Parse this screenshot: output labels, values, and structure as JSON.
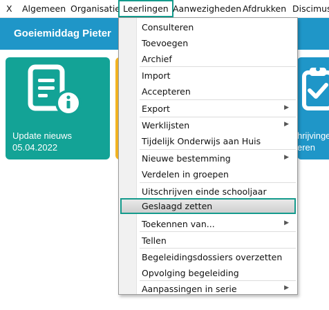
{
  "menubar": {
    "items": [
      "X",
      "Algemeen",
      "Organisatie",
      "Leerlingen",
      "Aanwezigheden",
      "Afdrukken",
      "Discimus"
    ],
    "active_index": 3
  },
  "header": {
    "greeting": "Goeiemiddag Pieter"
  },
  "tiles": {
    "news": {
      "line1": "Update nieuws",
      "line2": "05.04.2022",
      "color": "#13a396",
      "icon": "document-info-icon"
    },
    "yellow": {
      "color": "#f3b423"
    },
    "partial": {
      "line1": "hrijvinge",
      "line2": "eren",
      "color": "#1f96c8",
      "icon": "clipboard-check-icon"
    }
  },
  "dropdown": {
    "items": [
      {
        "label": "Consulteren",
        "submenu": false
      },
      {
        "label": "Toevoegen",
        "submenu": false
      },
      {
        "label": "Archief",
        "submenu": false
      },
      {
        "label": "Import",
        "submenu": false
      },
      {
        "label": "Accepteren",
        "submenu": false
      },
      {
        "label": "Export",
        "submenu": true
      },
      {
        "label": "Werklijsten",
        "submenu": true
      },
      {
        "label": "Tijdelijk Onderwijs aan Huis",
        "submenu": false
      },
      {
        "label": "Nieuwe bestemming",
        "submenu": true
      },
      {
        "label": "Verdelen in groepen",
        "submenu": false
      },
      {
        "label": "Uitschrijven einde schooljaar",
        "submenu": false
      },
      {
        "label": "Geslaagd zetten",
        "submenu": false
      },
      {
        "label": "Toekennen van...",
        "submenu": true
      },
      {
        "label": "Tellen",
        "submenu": false
      },
      {
        "label": "Begeleidingsdossiers overzetten",
        "submenu": false
      },
      {
        "label": "Opvolging begeleiding",
        "submenu": false
      },
      {
        "label": "Aanpassingen in serie",
        "submenu": true
      }
    ],
    "highlighted_index": 11,
    "submenu_arrow": "▶"
  }
}
